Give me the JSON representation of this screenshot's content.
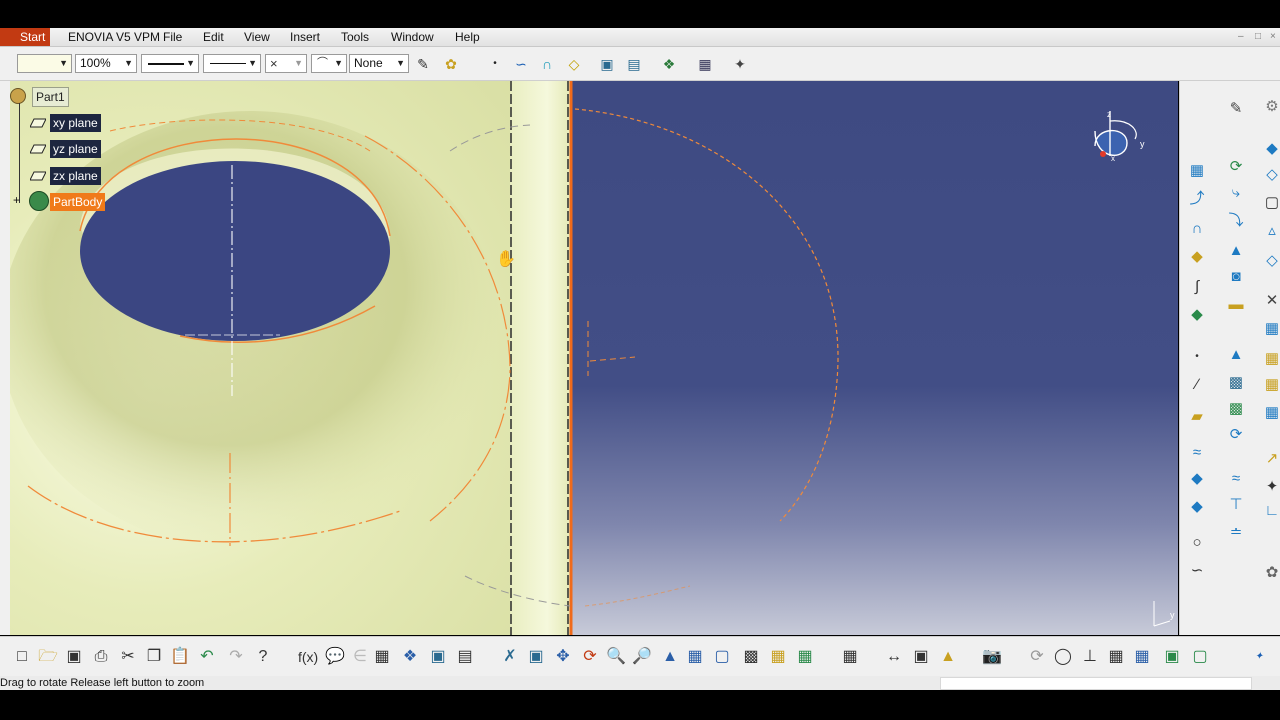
{
  "menu": {
    "items": [
      {
        "label": "Start"
      },
      {
        "label": "ENOVIA V5 VPM"
      },
      {
        "label": "File"
      },
      {
        "label": "Edit"
      },
      {
        "label": "View"
      },
      {
        "label": "Insert"
      },
      {
        "label": "Tools"
      },
      {
        "label": "Window"
      },
      {
        "label": "Help"
      }
    ]
  },
  "toolbar": {
    "zoom_value": "100%",
    "layer_value": "None"
  },
  "tree": {
    "root": "Part1",
    "items": [
      {
        "label": "xy plane"
      },
      {
        "label": "yz plane"
      },
      {
        "label": "zx plane"
      },
      {
        "label": "PartBody"
      }
    ]
  },
  "compass": {
    "axis_y": "y",
    "axis_x": "x",
    "axis_z": "z"
  },
  "status": {
    "message": "Drag to rotate  Release left button to zoom"
  },
  "colors": {
    "background_top": "#3e4a82",
    "part_surface": "#e9eebc",
    "selection": "#f07a1a",
    "edge_highlight": "#f08a3a"
  }
}
